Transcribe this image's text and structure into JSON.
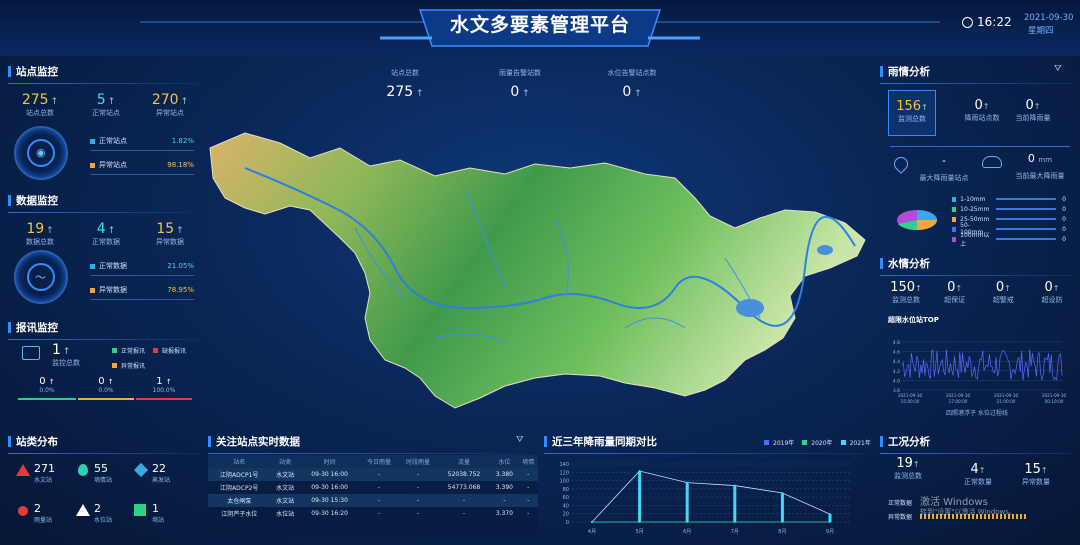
{
  "header": {
    "title": "水文多要素管理平台",
    "time": "16:22",
    "date": "2021-09-30",
    "weekday": "星期四"
  },
  "station_monitor": {
    "title": "站点监控",
    "total": {
      "value": "275",
      "label": "站点总数"
    },
    "normal": {
      "value": "5",
      "label": "正常站点"
    },
    "abnormal": {
      "value": "270",
      "label": "异常站点"
    },
    "normal_pct": {
      "label": "正常站点",
      "value": "1.82%"
    },
    "abnormal_pct": {
      "label": "异常站点",
      "value": "98.18%"
    }
  },
  "data_monitor": {
    "title": "数据监控",
    "total": {
      "value": "19",
      "label": "数据总数"
    },
    "normal": {
      "value": "4",
      "label": "正常数据"
    },
    "abnormal": {
      "value": "15",
      "label": "异常数据"
    },
    "normal_pct": {
      "label": "正常数据",
      "value": "21.05%"
    },
    "abnormal_pct": {
      "label": "异常数据",
      "value": "78.95%"
    }
  },
  "alert_monitor": {
    "title": "报讯监控",
    "total": {
      "value": "1",
      "label": "监控总数"
    },
    "legend": [
      "正常报讯",
      "缺报报讯",
      "异常报讯"
    ],
    "stats": [
      {
        "value": "0",
        "pct": "0.0%"
      },
      {
        "value": "0",
        "pct": "0.0%"
      },
      {
        "value": "1",
        "pct": "100.0%"
      }
    ]
  },
  "station_types": {
    "title": "站类分布",
    "items": [
      {
        "value": "271",
        "label": "水文站",
        "color": "#e23b3b"
      },
      {
        "value": "55",
        "label": "墒情站",
        "color": "#2ed1b3"
      },
      {
        "value": "22",
        "label": "蒸发站",
        "color": "#3aa8e6"
      },
      {
        "value": "2",
        "label": "雨量站",
        "color": "#e23b3b"
      },
      {
        "value": "2",
        "label": "水位站",
        "color": "#e23b3b"
      },
      {
        "value": "1",
        "label": "墒站",
        "color": "#2ed18a"
      }
    ]
  },
  "top_stats": [
    {
      "label": "站点总数",
      "value": "275"
    },
    {
      "label": "雨量告警站数",
      "value": "0"
    },
    {
      "label": "水位告警站点数",
      "value": "0"
    }
  ],
  "realtime": {
    "title": "关注站点实时数据",
    "columns": [
      "站名",
      "站类",
      "时间",
      "今日雨量",
      "时段雨量",
      "流量",
      "水位",
      "墒情"
    ],
    "rows": [
      [
        "江阴ADCP1号",
        "水文站",
        "09-30 16:00",
        "-",
        "-",
        "52038.752",
        "3.380",
        "-"
      ],
      [
        "江阴ADCP2号",
        "水文站",
        "09-30 16:00",
        "-",
        "-",
        "54773.068",
        "3.390",
        "-"
      ],
      [
        "太仓闸泵",
        "水文站",
        "09-30 15:30",
        "-",
        "-",
        "-",
        "-",
        "-"
      ],
      [
        "江阴芦子水位",
        "水位站",
        "09-30 16:20",
        "-",
        "-",
        "-",
        "3.370",
        "-"
      ]
    ]
  },
  "rain_compare": {
    "title": "近三年降雨量同期对比",
    "legend": [
      "2019年",
      "2020年",
      "2021年"
    ]
  },
  "rain_analysis": {
    "title": "雨情分析",
    "monitor_total": {
      "value": "156",
      "label": "监测总数"
    },
    "rain_stations": {
      "value": "0",
      "label": "降雨站点数"
    },
    "max_rain": {
      "value": "0",
      "label": "当前降雨量"
    },
    "max_station": {
      "value": "-",
      "label": "最大降雨量站点"
    },
    "max_amount": {
      "value": "0",
      "unit": "mm",
      "label": "当前最大降雨量"
    },
    "ranges": [
      {
        "label": "1-10mm",
        "value": "0"
      },
      {
        "label": "10-25mm",
        "value": "0"
      },
      {
        "label": "25-50mm",
        "value": "0"
      },
      {
        "label": "50-100mm",
        "value": "0"
      },
      {
        "label": "100mm以上",
        "value": "0"
      }
    ]
  },
  "water_analysis": {
    "title": "水情分析",
    "items": [
      {
        "value": "150",
        "label": "监测总数"
      },
      {
        "value": "0",
        "label": "超保证"
      },
      {
        "value": "0",
        "label": "超警戒"
      },
      {
        "value": "0",
        "label": "超设防"
      }
    ],
    "top_title": "超限水位站TOP",
    "chart_caption": "四照港浮子 水位过程线"
  },
  "work_analysis": {
    "title": "工况分析",
    "total": {
      "value": "19",
      "label": "监测总数"
    },
    "normal": {
      "value": "4",
      "label": "正常数量"
    },
    "abnormal": {
      "value": "15",
      "label": "异常数量"
    },
    "row1": "正常数据",
    "row2": "异常数据",
    "watermark1": "激活 Windows",
    "watermark2": "转到\"设置\"以激活 Windows。"
  },
  "chart_data": [
    {
      "type": "line",
      "title": "近三年降雨量同期对比",
      "categories": [
        "4月",
        "5月",
        "6月",
        "7月",
        "8月",
        "9月"
      ],
      "series": [
        {
          "name": "2019年",
          "values": [
            0,
            0,
            0,
            0,
            0,
            0
          ]
        },
        {
          "name": "2020年",
          "values": [
            0,
            0,
            0,
            0,
            0,
            0
          ]
        },
        {
          "name": "2021年",
          "values": [
            0,
            123,
            95,
            88,
            70,
            19
          ]
        }
      ],
      "ylim": [
        0,
        140
      ],
      "yticks": [
        0,
        20,
        40,
        60,
        80,
        100,
        120,
        140
      ]
    },
    {
      "type": "line",
      "title": "超限水位站TOP",
      "x_labels": [
        "2021-09-30 15:00:00",
        "2021-09-30 17:00:00",
        "2021-09-30 21:00:00",
        "2021-09-30 00:10:00"
      ],
      "yticks": [
        3.8,
        4.0,
        4.2,
        4.4,
        4.6,
        4.8
      ],
      "ylim": [
        3.8,
        4.8
      ]
    }
  ]
}
